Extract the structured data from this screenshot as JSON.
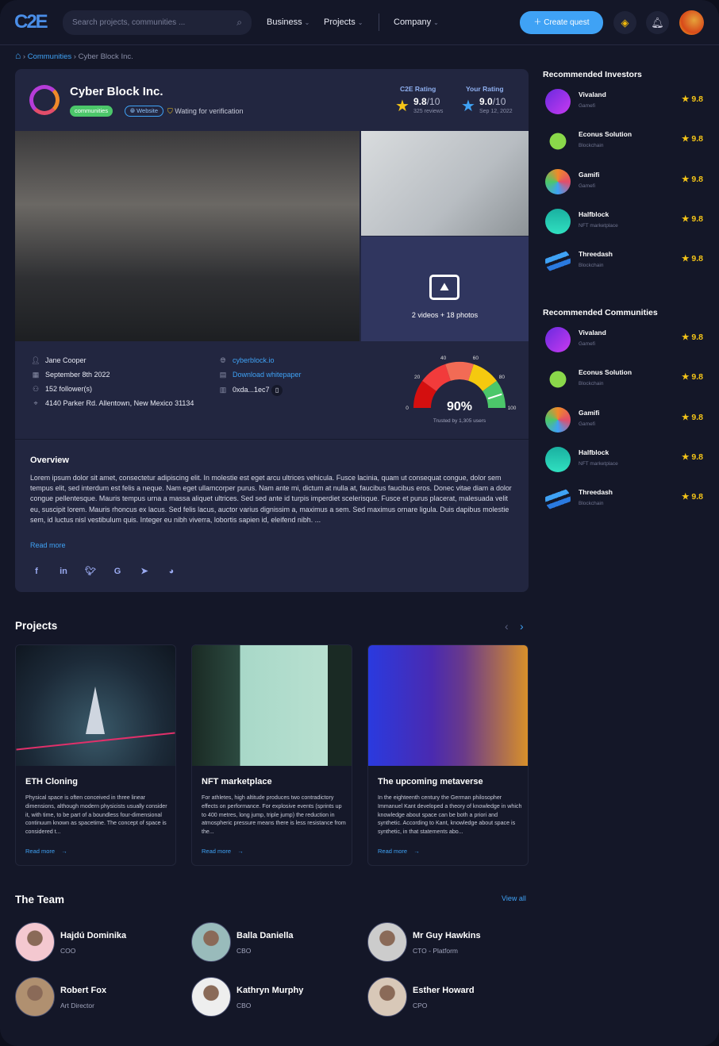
{
  "header": {
    "logo": "C2E",
    "search_placeholder": "Search projects, communities ...",
    "nav": [
      "Business",
      "Projects",
      "Company"
    ],
    "create_label": "Create quest"
  },
  "breadcrumb": [
    "Communities",
    "Cyber Block Inc."
  ],
  "company": {
    "name": "Cyber Block Inc.",
    "tag": "communities",
    "website_tag": "Website",
    "verification": "Wating for verification",
    "c2e_rating": {
      "label": "C2E Rating",
      "value": "9.8",
      "max": "/10",
      "sub": "325 reviews"
    },
    "your_rating": {
      "label": "Your Rating",
      "value": "9.0",
      "max": "/10",
      "sub": "Sep 12, 2022"
    },
    "gallery_overlay": "2 videos + 18 photos",
    "owner": "Jane Cooper",
    "date": "September 8th 2022",
    "followers": "152 follower(s)",
    "address": "4140 Parker Rd. Allentown, New Mexico 31134",
    "website": "cyberblock.io",
    "whitepaper": "Download whitepaper",
    "wallet": "0xda...1ec7",
    "trust": {
      "percent": 90,
      "label": "90%",
      "sub": "Trusted by 1,305 users",
      "ticks": [
        "0",
        "20",
        "40",
        "60",
        "80",
        "100"
      ]
    },
    "overview_title": "Overview",
    "overview": "Lorem ipsum dolor sit amet, consectetur adipiscing elit. In molestie est eget arcu ultrices vehicula. Fusce lacinia, quam ut consequat congue, dolor sem tempus elit, sed interdum est felis a neque. Nam eget ullamcorper purus. Nam ante mi, dictum at nulla at, faucibus faucibus eros. Donec vitae diam a dolor congue pellentesque. Mauris tempus urna a massa aliquet ultrices. Sed sed ante id turpis imperdiet scelerisque. Fusce et purus placerat, malesuada velit eu, suscipit lorem. Mauris rhoncus ex lacus. Sed felis lacus, auctor varius dignissim a, maximus a sem. Sed maximus ornare ligula. Duis dapibus molestie sem, id luctus nisl vestibulum quis. Integer eu nibh viverra, lobortis sapien id, eleifend nibh. ...",
    "read_more": "Read more"
  },
  "projects": {
    "title": "Projects",
    "items": [
      {
        "title": "ETH Cloning",
        "desc": "Physical space is often conceived in three linear dimensions, although modern physicists usually consider it, with time, to be part of a boundless four-dimensional continuum known as spacetime. The concept of space is considered t...",
        "link": "Read more"
      },
      {
        "title": "NFT marketplace",
        "desc": "For athletes, high altitude produces two contradictory effects on performance. For explosive events (sprints up to 400 metres, long jump, triple jump) the reduction in atmospheric pressure means there is less resistance from the...",
        "link": "Read more"
      },
      {
        "title": "The upcoming metaverse",
        "desc": "In the eighteenth century the German philosopher Immanuel Kant developed a theory of knowledge in which knowledge about space can be both a priori and synthetic. According to Kant, knowledge about space is synthetic, in that statements abo...",
        "link": "Read more"
      }
    ]
  },
  "team": {
    "title": "The Team",
    "view_all": "View all",
    "members": [
      {
        "name": "Hajdú Dominika",
        "role": "COO"
      },
      {
        "name": "Balla Daniella",
        "role": "CBO"
      },
      {
        "name": "Mr Guy Hawkins",
        "role": "CTO - Platform"
      },
      {
        "name": "Robert Fox",
        "role": "Art Director"
      },
      {
        "name": "Kathryn Murphy",
        "role": "CBO"
      },
      {
        "name": "Esther Howard",
        "role": "CPO"
      }
    ]
  },
  "investors": {
    "title": "Recommended Investors",
    "items": [
      {
        "name": "Vivaland",
        "cat": "Gamefi",
        "score": "9.8"
      },
      {
        "name": "Econus Solution",
        "cat": "Blockchain",
        "score": "9.8"
      },
      {
        "name": "Gamifi",
        "cat": "Gamefi",
        "score": "9.8"
      },
      {
        "name": "Halfblock",
        "cat": "NFT marketplace",
        "score": "9.8"
      },
      {
        "name": "Threedash",
        "cat": "Blockchain",
        "score": "9.8"
      }
    ]
  },
  "communities": {
    "title": "Recommended Communities",
    "items": [
      {
        "name": "Vivaland",
        "cat": "Gamefi",
        "score": "9.8"
      },
      {
        "name": "Econus Solution",
        "cat": "Blockchain",
        "score": "9.8"
      },
      {
        "name": "Gamifi",
        "cat": "Gamefi",
        "score": "9.8"
      },
      {
        "name": "Halfblock",
        "cat": "NFT marketplace",
        "score": "9.8"
      },
      {
        "name": "Threedash",
        "cat": "Blockchain",
        "score": "9.8"
      }
    ]
  }
}
